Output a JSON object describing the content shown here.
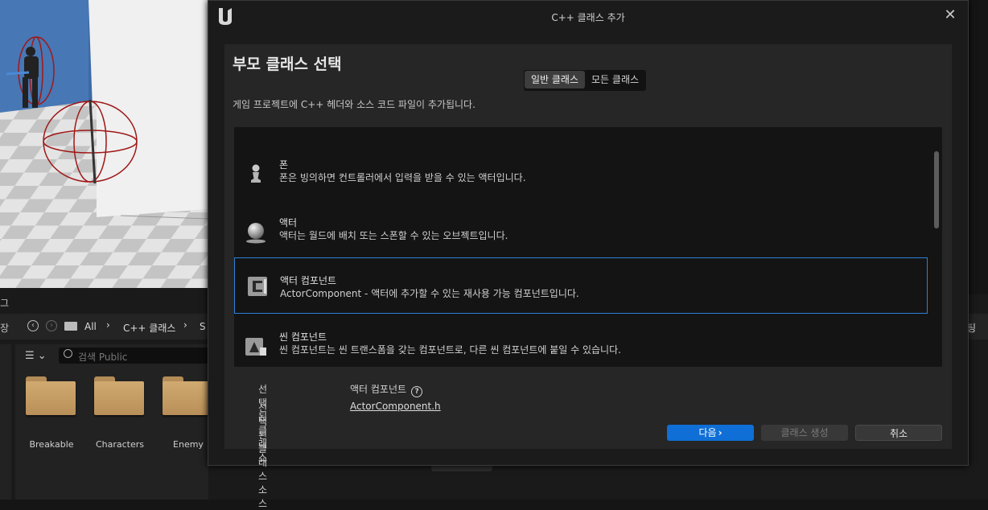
{
  "dialog": {
    "title": "C++ 클래스 추가",
    "heading": "부모 클래스 선택",
    "tabs": [
      {
        "label": "일반 클래스",
        "active": true
      },
      {
        "label": "모든 클래스",
        "active": false
      }
    ],
    "description": "게임 프로젝트에 C++ 헤더와 소스 코드 파일이 추가됩니다.",
    "classes": [
      {
        "name": "폰",
        "description": "폰은 빙의하면 컨트롤러에서 입력을 받을 수 있는 액터입니다.",
        "icon": "pawn-icon",
        "selected": false
      },
      {
        "name": "액터",
        "description": "액터는 월드에 배치 또는 스폰할 수 있는 오브젝트입니다.",
        "icon": "actor-sphere-icon",
        "selected": false
      },
      {
        "name": "액터 컴포넌트",
        "description": "ActorComponent - 액터에 추가할 수 있는 재사용 가능 컴포넌트입니다.",
        "icon": "actor-component-icon",
        "selected": true
      },
      {
        "name": "씬 컴포넌트",
        "description": "씬 컴포넌트는 씬 트랜스폼을 갖는 컴포넌트로, 다른 씬 컴포넌트에 붙일 수 있습니다.",
        "icon": "scene-component-icon",
        "selected": false
      }
    ],
    "selected_class_label": "선택된 클래스",
    "selected_class_value": "액터 컴포넌트",
    "selected_source_label": "선택된 클래스 소스",
    "selected_source_value": "ActorComponent.h",
    "buttons": {
      "next": "다음",
      "create": "클래스 생성",
      "cancel": "취소"
    }
  },
  "content_browser": {
    "tab_fragment": "그",
    "save_fragment": "장",
    "path": [
      "All",
      "C++ 클래스",
      "S"
    ],
    "search_placeholder": "검색 Public",
    "right_fragment": "팅",
    "folders": [
      "Breakable",
      "Characters",
      "Enemy"
    ]
  },
  "colors": {
    "accent": "#0f6fd6",
    "selection_border": "#2f7fd6",
    "folder": "#c9a46a"
  }
}
